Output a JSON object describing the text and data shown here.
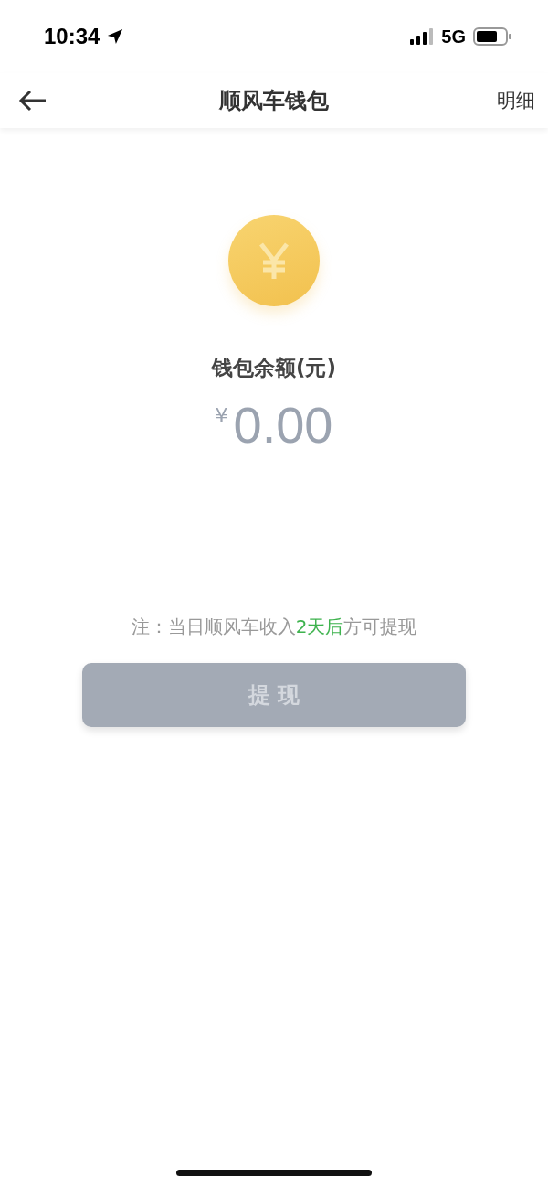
{
  "status_bar": {
    "time": "10:34",
    "network": "5G"
  },
  "nav": {
    "title": "顺风车钱包",
    "action": "明细"
  },
  "wallet": {
    "label": "钱包余额(元)",
    "currency": "¥",
    "amount": "0.00"
  },
  "note": {
    "before": "注：当日顺风车收入",
    "highlight": "2天后",
    "after": "方可提现"
  },
  "withdraw_button": {
    "label": "提 现",
    "disabled": true
  }
}
